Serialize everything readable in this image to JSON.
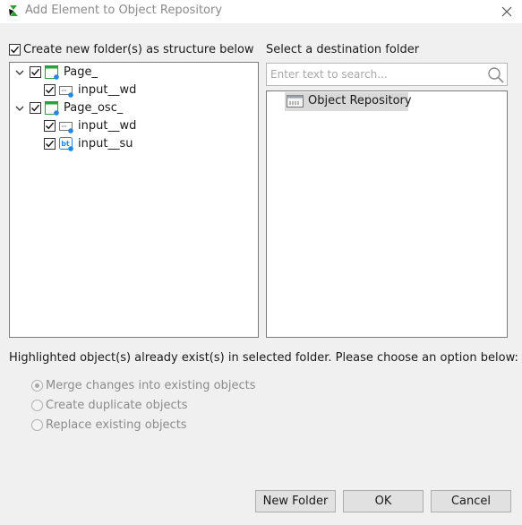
{
  "window": {
    "title": "Add Element to Object Repository",
    "app_icon": "katalon-leaf-icon",
    "close_icon": "close-icon"
  },
  "left": {
    "create_folders_label": "Create new folder(s) as structure below",
    "create_folders_checked": true,
    "tree": [
      {
        "label": "Page_",
        "checked": true,
        "icon": "page-icon",
        "children": [
          {
            "label": "input__wd",
            "checked": true,
            "icon": "textbox-icon"
          }
        ]
      },
      {
        "label": "Page_osc_",
        "checked": true,
        "icon": "page-icon",
        "children": [
          {
            "label": "input__wd",
            "checked": true,
            "icon": "textbox-icon"
          },
          {
            "label": "input__su",
            "checked": true,
            "icon": "button-bt-icon"
          }
        ]
      }
    ]
  },
  "right": {
    "dest_label": "Select a destination folder",
    "search_placeholder": "Enter text to search...",
    "search_icon": "search-icon",
    "root_folder": "Object Repository",
    "root_icon": "repository-icon"
  },
  "options": {
    "message": "Highlighted object(s) already exist(s) in selected folder. Please choose an option below:",
    "items": [
      "Merge changes into existing objects",
      "Create duplicate objects",
      "Replace existing objects"
    ],
    "selected_index": 0
  },
  "buttons": {
    "new_folder": "New Folder",
    "ok": "OK",
    "cancel": "Cancel"
  },
  "colors": {
    "accent_blue": "#1e88e5",
    "page_green": "#2e9e3a",
    "selection_gray": "#d9d9d9"
  }
}
